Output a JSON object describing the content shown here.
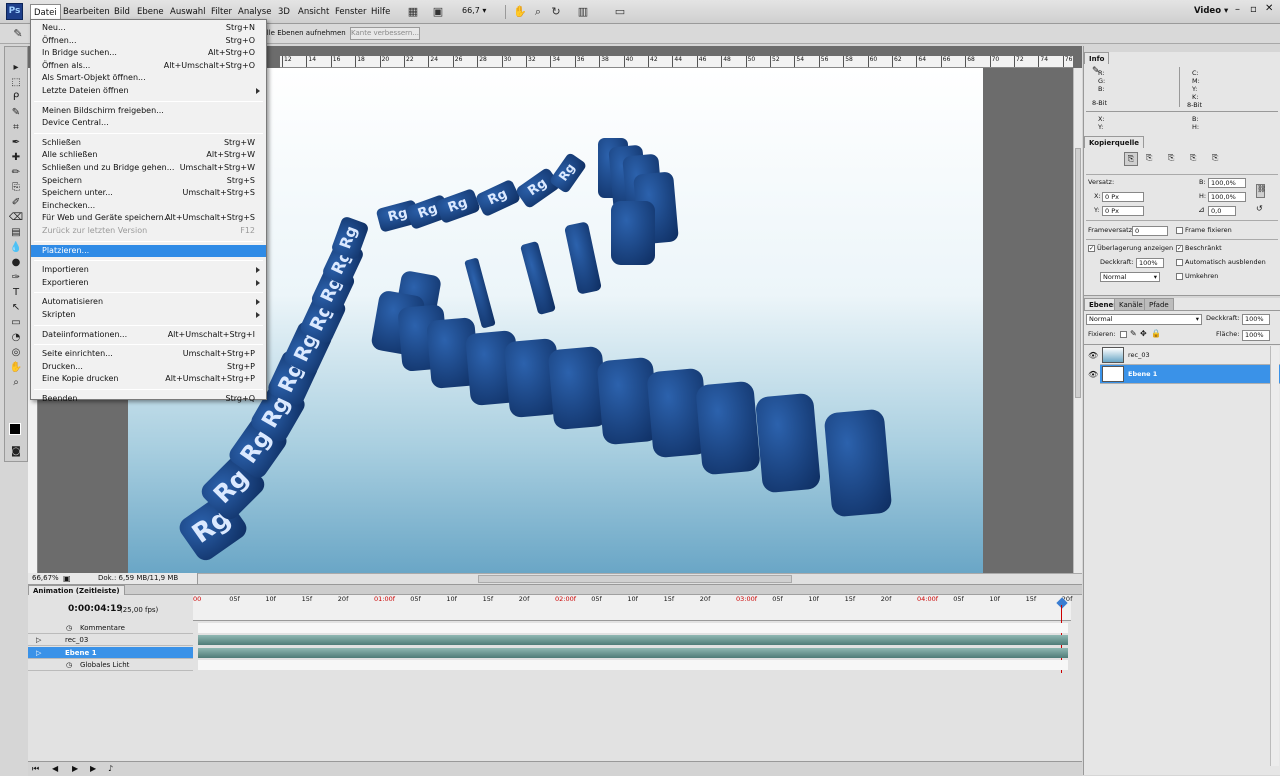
{
  "menubar": {
    "logo": "Ps",
    "items": [
      "Datei",
      "Bearbeiten",
      "Bild",
      "Ebene",
      "Auswahl",
      "Filter",
      "Analyse",
      "3D",
      "Ansicht",
      "Fenster",
      "Hilfe"
    ],
    "zoom": "66,7",
    "workspace": "Video"
  },
  "options": {
    "check_label": "Alle Ebenen aufnehmen",
    "button": "Kante verbessern..."
  },
  "file_menu": [
    {
      "label": "Neu...",
      "shortcut": "Strg+N"
    },
    {
      "label": "Öffnen...",
      "shortcut": "Strg+O"
    },
    {
      "label": "In Bridge suchen...",
      "shortcut": "Alt+Strg+O"
    },
    {
      "label": "Öffnen als...",
      "shortcut": "Alt+Umschalt+Strg+O"
    },
    {
      "label": "Als Smart-Objekt öffnen...",
      "shortcut": ""
    },
    {
      "label": "Letzte Dateien öffnen",
      "shortcut": "",
      "sub": true
    },
    {
      "sep": true
    },
    {
      "label": "Meinen Bildschirm freigeben...",
      "shortcut": ""
    },
    {
      "label": "Device Central...",
      "shortcut": ""
    },
    {
      "sep": true
    },
    {
      "label": "Schließen",
      "shortcut": "Strg+W"
    },
    {
      "label": "Alle schließen",
      "shortcut": "Alt+Strg+W"
    },
    {
      "label": "Schließen und zu Bridge gehen...",
      "shortcut": "Umschalt+Strg+W"
    },
    {
      "label": "Speichern",
      "shortcut": "Strg+S"
    },
    {
      "label": "Speichern unter...",
      "shortcut": "Umschalt+Strg+S"
    },
    {
      "label": "Einchecken...",
      "shortcut": ""
    },
    {
      "label": "Für Web und Geräte speichern...",
      "shortcut": "Alt+Umschalt+Strg+S"
    },
    {
      "label": "Zurück zur letzten Version",
      "shortcut": "F12",
      "disabled": true
    },
    {
      "sep": true
    },
    {
      "label": "Platzieren...",
      "shortcut": "",
      "highlight": true
    },
    {
      "sep": true
    },
    {
      "label": "Importieren",
      "shortcut": "",
      "sub": true
    },
    {
      "label": "Exportieren",
      "shortcut": "",
      "sub": true
    },
    {
      "sep": true
    },
    {
      "label": "Automatisieren",
      "shortcut": "",
      "sub": true
    },
    {
      "label": "Skripten",
      "shortcut": "",
      "sub": true
    },
    {
      "sep": true
    },
    {
      "label": "Dateiinformationen...",
      "shortcut": "Alt+Umschalt+Strg+I"
    },
    {
      "sep": true
    },
    {
      "label": "Seite einrichten...",
      "shortcut": "Umschalt+Strg+P"
    },
    {
      "label": "Drucken...",
      "shortcut": "Strg+P"
    },
    {
      "label": "Eine Kopie drucken",
      "shortcut": "Alt+Umschalt+Strg+P"
    },
    {
      "sep": true
    },
    {
      "label": "Beenden",
      "shortcut": "Strg+Q"
    }
  ],
  "status": {
    "zoom": "66,67%",
    "doc": "Dok.: 6,59 MB/11,9 MB"
  },
  "ruler_labels": [
    "12",
    "14",
    "16",
    "18",
    "20",
    "22",
    "24",
    "26",
    "28",
    "30",
    "32",
    "34",
    "36",
    "38",
    "40",
    "42",
    "44",
    "46",
    "48",
    "50",
    "52",
    "54",
    "56",
    "58",
    "60",
    "62",
    "64",
    "66",
    "68",
    "70",
    "72",
    "74",
    "76",
    "78"
  ],
  "info": {
    "tab": "Info",
    "left": [
      "R:",
      "G:",
      "B:"
    ],
    "right": [
      "C:",
      "M:",
      "Y:",
      "K:"
    ],
    "bit": "8-Bit",
    "xy": [
      "X:",
      "Y:"
    ],
    "bh": [
      "B:",
      "H:"
    ]
  },
  "clone": {
    "tab": "Kopierquelle",
    "versatz": "Versatz:",
    "x_label": "X:",
    "x_val": "0 Px",
    "y_label": "Y:",
    "y_val": "0 Px",
    "b_label": "B:",
    "b_val": "100,0%",
    "h_label": "H:",
    "h_val": "100,0%",
    "angle_val": "0,0",
    "frameversatz": "Frameversatz:",
    "frame_val": "0",
    "frame_fix": "Frame fixieren",
    "overlay": "Überlagerung anzeigen",
    "beschraenkt": "Beschränkt",
    "deckkraft": "Deckkraft:",
    "deck_val": "100%",
    "auto": "Automatisch ausblenden",
    "mode": "Normal",
    "umkehren": "Umkehren"
  },
  "layers": {
    "tabs": [
      "Ebenen",
      "Kanäle",
      "Pfade"
    ],
    "mode": "Normal",
    "opacity_label": "Deckkraft:",
    "opacity": "100%",
    "lock_label": "Fixieren:",
    "fill_label": "Fläche:",
    "fill": "100%",
    "items": [
      "rec_03",
      "Ebene 1"
    ]
  },
  "anim": {
    "title": "Animation (Zeitleiste)",
    "time": "0:00:04:19",
    "fps": "(25,00 fps)",
    "tracks": [
      "Kommentare",
      "rec_03",
      "Ebene 1",
      "Globales Licht"
    ],
    "ticks": [
      "00",
      "05f",
      "10f",
      "15f",
      "20f",
      "01:00f",
      "05f",
      "10f",
      "15f",
      "20f",
      "02:00f",
      "05f",
      "10f",
      "15f",
      "20f",
      "03:00f",
      "05f",
      "10f",
      "15f",
      "20f",
      "04:00f",
      "05f",
      "10f",
      "15f",
      "20f"
    ]
  },
  "canvas_text": "Rg",
  "colors": {
    "accent": "#3a92e8",
    "menu_hl": "#2f8be6",
    "domino": "#1d4a8c",
    "red_tick": "#cc0000"
  }
}
